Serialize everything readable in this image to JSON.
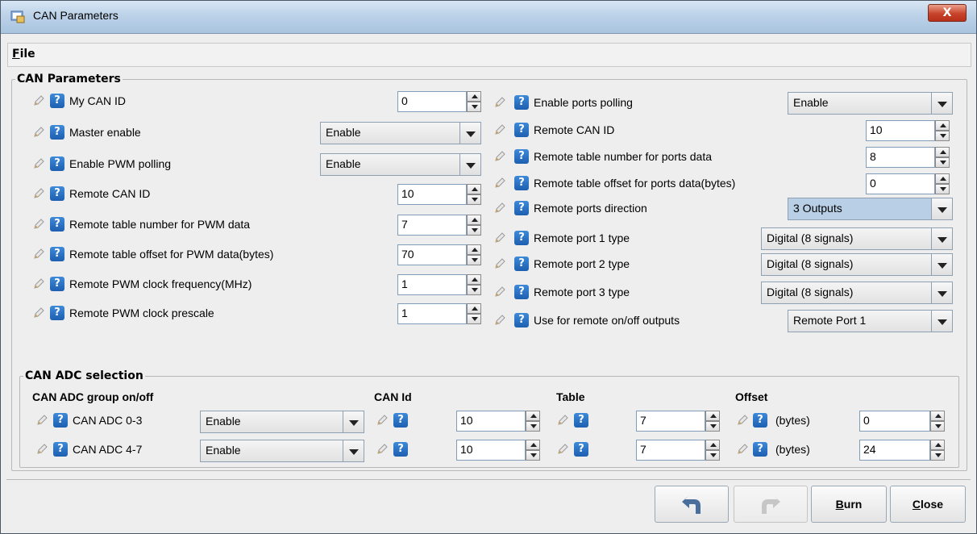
{
  "window": {
    "title": "CAN Parameters",
    "close_glyph": "X"
  },
  "menu": {
    "file_label": "File",
    "file_mnemonic": "F",
    "file_rest": "ile"
  },
  "params": {
    "legend": "CAN Parameters",
    "left": [
      {
        "label": "My CAN ID",
        "kind": "spin",
        "value": "0"
      },
      {
        "label": "Master enable",
        "kind": "combo",
        "value": "Enable"
      },
      {
        "label": "Enable PWM polling",
        "kind": "combo",
        "value": "Enable"
      },
      {
        "label": "Remote CAN ID",
        "kind": "spin",
        "value": "10"
      },
      {
        "label": "Remote table number for PWM data",
        "kind": "spin",
        "value": "7"
      },
      {
        "label": "Remote table offset for PWM data(bytes)",
        "kind": "spin",
        "value": "70"
      },
      {
        "label": "Remote PWM clock frequency(MHz)",
        "kind": "spin",
        "value": "1"
      },
      {
        "label": "Remote PWM clock prescale",
        "kind": "spin",
        "value": "1"
      }
    ],
    "right": [
      {
        "label": "Enable ports polling",
        "kind": "combo",
        "value": "Enable"
      },
      {
        "label": "Remote CAN ID",
        "kind": "spin",
        "value": "10"
      },
      {
        "label": "Remote table number for ports data",
        "kind": "spin",
        "value": "8"
      },
      {
        "label": "Remote table offset for ports data(bytes)",
        "kind": "spin",
        "value": "0"
      },
      {
        "label": "Remote ports direction",
        "kind": "combo",
        "value": "3 Outputs"
      },
      {
        "label": "Remote port 1 type",
        "kind": "combo",
        "value": "Digital (8 signals)"
      },
      {
        "label": "Remote port 2 type",
        "kind": "combo",
        "value": "Digital (8 signals)"
      },
      {
        "label": "Remote port 3 type",
        "kind": "combo",
        "value": "Digital (8 signals)"
      },
      {
        "label": "Use for remote on/off outputs",
        "kind": "combo",
        "value": "Remote Port 1"
      }
    ]
  },
  "adc": {
    "legend": "CAN ADC selection",
    "headers": {
      "group": "CAN ADC group on/off",
      "canid": "CAN Id",
      "table": "Table",
      "offset": "Offset"
    },
    "rows": [
      {
        "label": "CAN ADC 0-3",
        "group": "Enable",
        "canid": "10",
        "table": "7",
        "offset_label": "(bytes)",
        "offset": "0"
      },
      {
        "label": "CAN ADC 4-7",
        "group": "Enable",
        "canid": "10",
        "table": "7",
        "offset_label": "(bytes)",
        "offset": "24"
      }
    ]
  },
  "buttons": {
    "undo_icon": "undo-arrow-icon",
    "redo_icon": "redo-arrow-icon",
    "burn": "Burn",
    "burn_mnemonic": "B",
    "burn_rest": "urn",
    "close": "Close",
    "close_mnemonic": "C",
    "close_rest": "lose"
  },
  "icons": {
    "pencil": "pencil-icon",
    "help": "?",
    "app": "app-icon"
  },
  "colors": {
    "help_blue": "#1d5fb0",
    "selected_combo": "#b8cfe5",
    "close_red": "#c8432b"
  }
}
